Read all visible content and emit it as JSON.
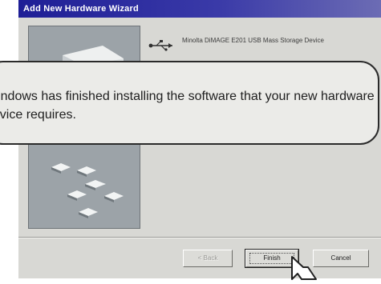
{
  "window": {
    "title": "Add New Hardware Wizard"
  },
  "device": {
    "icon": "usb-icon",
    "name": "Minolta DiMAGE E201 USB Mass Storage Device"
  },
  "buttons": {
    "back": "< Back",
    "finish": "Finish",
    "cancel": "Cancel"
  },
  "callout": {
    "message": "Windows has finished installing the software that your new hardware device requires."
  },
  "colors": {
    "titlebar": "#1e1e96",
    "dialog": "#d8d8d4",
    "callout_bg": "#ebebe8"
  }
}
